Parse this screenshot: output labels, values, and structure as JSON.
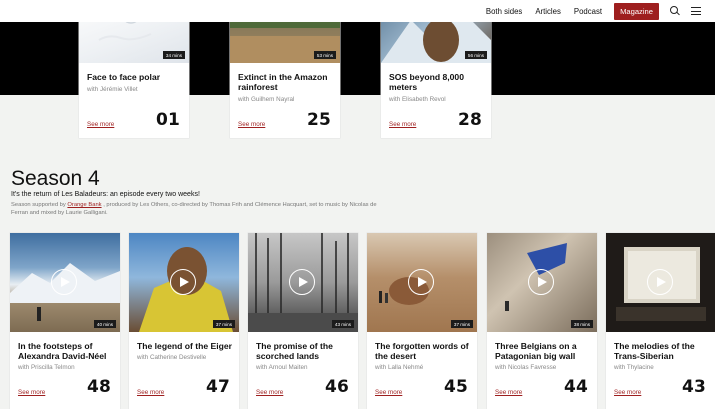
{
  "nav": {
    "links": [
      "Both sides",
      "Articles",
      "Podcast"
    ],
    "magazine": "Magazine",
    "search_icon": "search-icon",
    "menu_icon": "menu-icon"
  },
  "colors": {
    "accent": "#9e1f1f",
    "band": "#000000",
    "background": "#f2f3f1"
  },
  "top_cards": [
    {
      "title": "Face to face polar",
      "author": "with Jérémie Villet",
      "duration": "34 mins",
      "number": "01",
      "see_more": "See more"
    },
    {
      "title": "Extinct in the Amazon rainforest",
      "author": "with Guilhem Nayral",
      "duration": "53 mins",
      "number": "25",
      "see_more": "See more"
    },
    {
      "title": "SOS beyond 8,000 meters",
      "author": "with Elisabeth Revol",
      "duration": "56 mins",
      "number": "28",
      "see_more": "See more"
    }
  ],
  "season": {
    "title": "Season 4",
    "subtitle": "It's the return of Les Baladeurs: an episode every two weeks!",
    "credits_pre": "Season supported by ",
    "credits_link": "Orange Bank",
    "credits_post": " , produced by Les Others, co-directed by Thomas Frih and Clémence Hacquart, set to music by Nicolas de Ferran and mixed by Laurie Galligani."
  },
  "episodes": [
    {
      "title": "In the footsteps of Alexandra David-Néel",
      "author": "with Priscilla Telmon",
      "duration": "40 mins",
      "number": "48",
      "see_more": "See more"
    },
    {
      "title": "The legend of the Eiger",
      "author": "with Catherine Destivelle",
      "duration": "37 mins",
      "number": "47",
      "see_more": "See more"
    },
    {
      "title": "The promise of the scorched lands",
      "author": "with Arnoul Maiten",
      "duration": "43 mins",
      "number": "46",
      "see_more": "See more"
    },
    {
      "title": "The forgotten words of the desert",
      "author": "with Lalla Nehmé",
      "duration": "37 mins",
      "number": "45",
      "see_more": "See more"
    },
    {
      "title": "Three Belgians on a Patagonian big wall",
      "author": "with Nicolas Favresse",
      "duration": "38 mins",
      "number": "44",
      "see_more": "See more"
    },
    {
      "title": "The melodies of the Trans-Siberian",
      "author": "with Thylacine",
      "duration": "",
      "number": "43",
      "see_more": "See more"
    }
  ]
}
